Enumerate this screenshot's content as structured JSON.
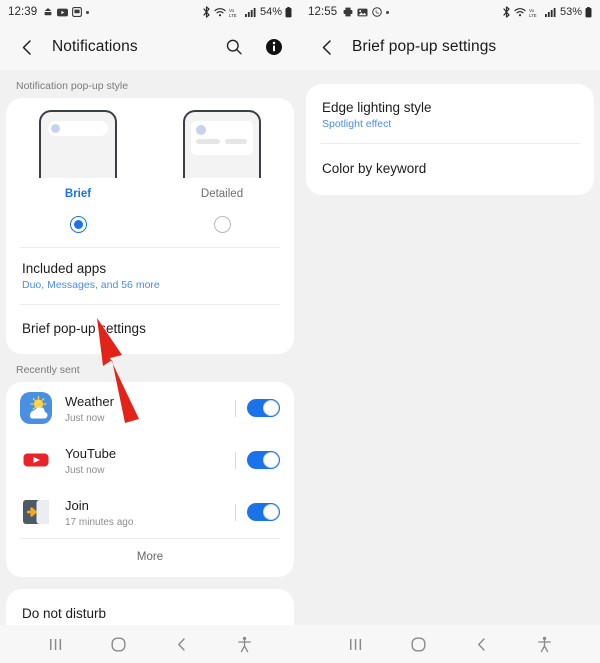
{
  "left": {
    "status": {
      "time": "12:39",
      "left_icons": [
        "app-notification-icon",
        "youtube-icon",
        "message-icon",
        "dot-icon"
      ],
      "right_icons": [
        "bluetooth-icon",
        "wifi-icon",
        "lte-data-icon",
        "signal-bars-icon"
      ],
      "battery_percent": "54%"
    },
    "appbar": {
      "back": "back-arrow",
      "title": "Notifications",
      "search": "search-icon",
      "info": "info-icon"
    },
    "popup_style": {
      "section_label": "Notification pop-up style",
      "options": [
        {
          "name": "Brief",
          "selected": true
        },
        {
          "name": "Detailed",
          "selected": false
        }
      ]
    },
    "included_apps": {
      "title": "Included apps",
      "subtitle": "Duo, Messages, and 56 more"
    },
    "brief_settings": {
      "title": "Brief pop-up settings"
    },
    "recently_sent": {
      "section_label": "Recently sent",
      "apps": [
        {
          "name": "Weather",
          "time": "Just now",
          "icon": "weather-app-icon",
          "enabled": true
        },
        {
          "name": "YouTube",
          "time": "Just now",
          "icon": "youtube-app-icon",
          "enabled": true
        },
        {
          "name": "Join",
          "time": "17 minutes ago",
          "icon": "join-app-icon",
          "enabled": true
        }
      ],
      "more_label": "More"
    },
    "dnd": {
      "title": "Do not disturb"
    },
    "navbar": [
      "recents-icon",
      "home-icon",
      "back-icon",
      "accessibility-icon"
    ]
  },
  "right": {
    "status": {
      "time": "12:55",
      "left_icons": [
        "print-icon",
        "image-icon",
        "whatsapp-icon",
        "dot-icon"
      ],
      "right_icons": [
        "bluetooth-icon",
        "wifi-icon",
        "lte-data-icon",
        "signal-bars-icon"
      ],
      "battery_percent": "53%"
    },
    "appbar": {
      "back": "back-arrow",
      "title": "Brief pop-up settings"
    },
    "items": [
      {
        "title": "Edge lighting style",
        "subtitle": "Spotlight effect"
      },
      {
        "title": "Color by keyword",
        "subtitle": ""
      }
    ],
    "navbar": [
      "recents-icon",
      "home-icon",
      "back-icon",
      "accessibility-icon"
    ]
  },
  "annotation": {
    "arrow": "red-pointer-arrow",
    "color": "#e2231a",
    "points_to": "Brief pop-up settings"
  },
  "colors": {
    "accent_blue": "#1a73e8",
    "link_blue": "#4b8ee8",
    "page_bg": "#f1f1f1",
    "card_bg": "#ffffff",
    "annotation_red": "#e2231a"
  }
}
